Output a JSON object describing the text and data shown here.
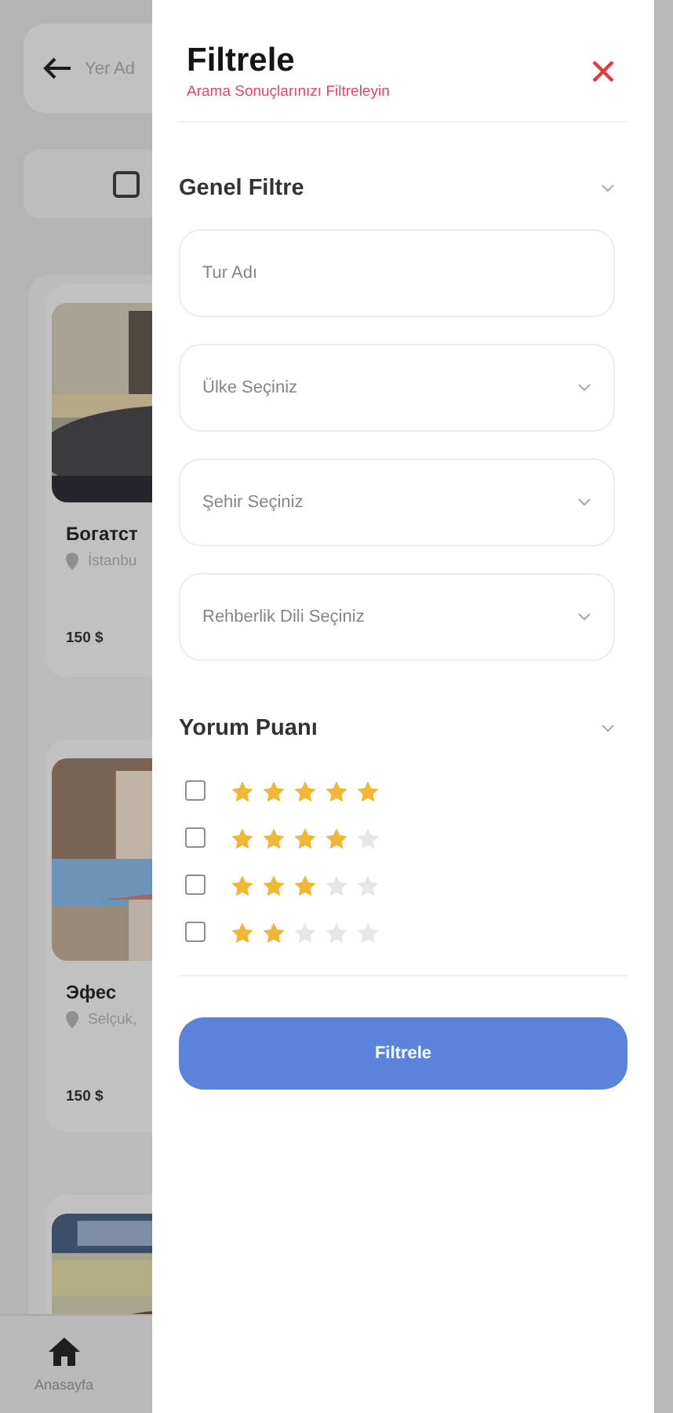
{
  "background": {
    "search": {
      "placeholder": "Yer Ad"
    },
    "cards": [
      {
        "kind": "tour",
        "title": "Богатст",
        "location": "İstanbu",
        "price": "150 $"
      },
      {
        "kind": "tour",
        "title": "Эфес",
        "location": "Selçuk,",
        "price": "150 $"
      },
      {
        "kind": "picture"
      }
    ],
    "nav": [
      {
        "label": "Anasayfa"
      }
    ]
  },
  "drawer": {
    "title": "Filtrele",
    "subtitle": "Arama Sonuçlarınızı Filtreleyin",
    "general": {
      "title": "Genel Filtre",
      "fields": [
        {
          "kind": "text",
          "placeholder": "Tur Adı"
        },
        {
          "kind": "select",
          "placeholder": "Ülke Seçiniz"
        },
        {
          "kind": "select",
          "placeholder": "Şehir Seçiniz"
        },
        {
          "kind": "select",
          "placeholder": "Rehberlik Dili Seçiniz"
        }
      ]
    },
    "rating": {
      "title": "Yorum Puanı",
      "options": [
        {
          "checked": false,
          "stars": 5
        },
        {
          "checked": false,
          "stars": 4
        },
        {
          "checked": false,
          "stars": 3
        },
        {
          "checked": false,
          "stars": 2
        }
      ]
    },
    "button": "Filtrele"
  }
}
